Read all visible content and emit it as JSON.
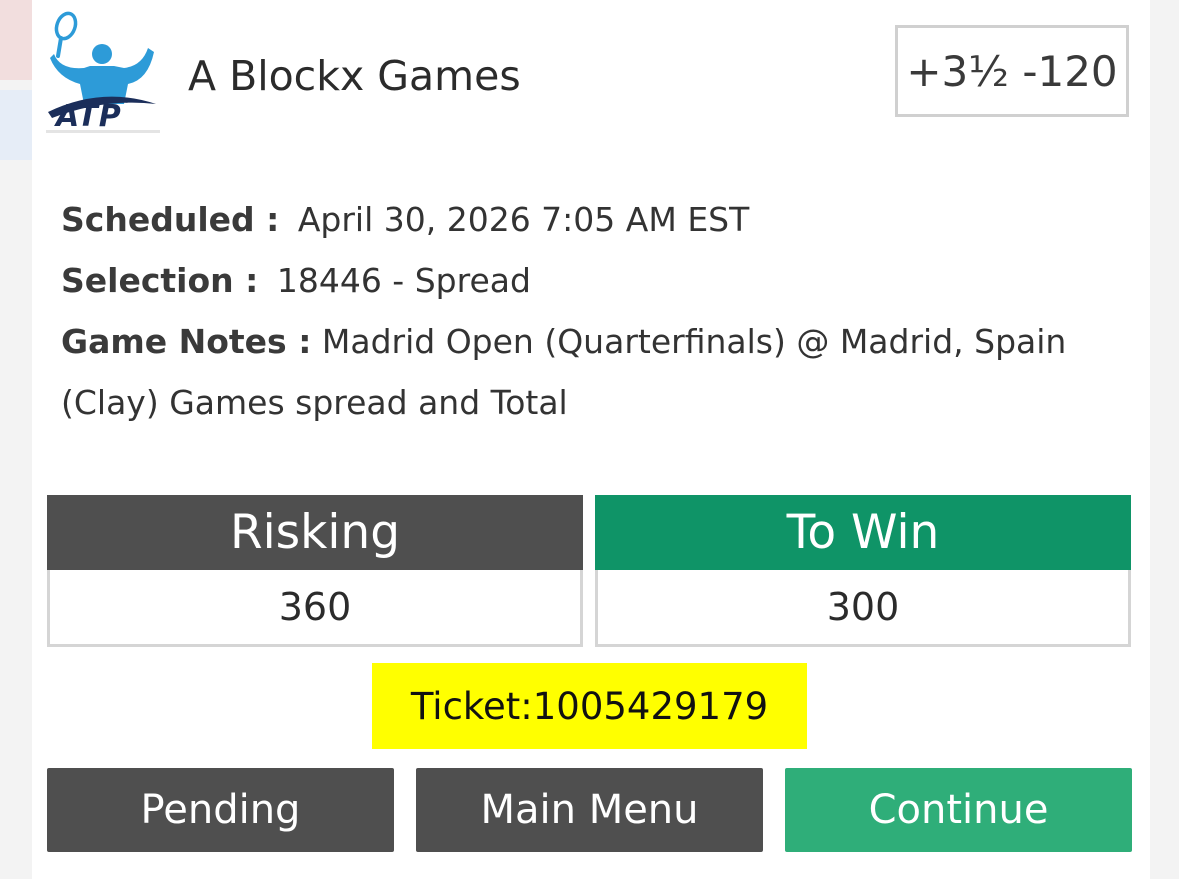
{
  "header": {
    "logo_text": "ATP",
    "title": "A Blockx Games",
    "odds": "+3½ -120"
  },
  "details": {
    "scheduled_label": "Scheduled :",
    "scheduled_value": "April 30, 2026 7:05 AM EST",
    "selection_label": "Selection :",
    "selection_value": "18446 - Spread",
    "notes_label": "Game Notes :",
    "notes_value_line1": "Madrid Open (Quarterfinals) @ Madrid, Spain",
    "notes_value_line2": "(Clay) Games spread and Total"
  },
  "wager": {
    "risking_label": "Risking",
    "risking_value": "360",
    "towin_label": "To Win",
    "towin_value": "300"
  },
  "ticket": {
    "text": "Ticket:1005429179"
  },
  "buttons": {
    "pending": "Pending",
    "main_menu": "Main Menu",
    "continue": "Continue"
  },
  "colors": {
    "risking_header": "#4f4f4f",
    "towin_header": "#0f9467",
    "ticket_highlight": "#ffff00",
    "continue_button": "#2fae79",
    "neutral_button": "#4f4f4f",
    "logo_blue": "#2d9bd8",
    "logo_navy": "#1b2e5a"
  }
}
